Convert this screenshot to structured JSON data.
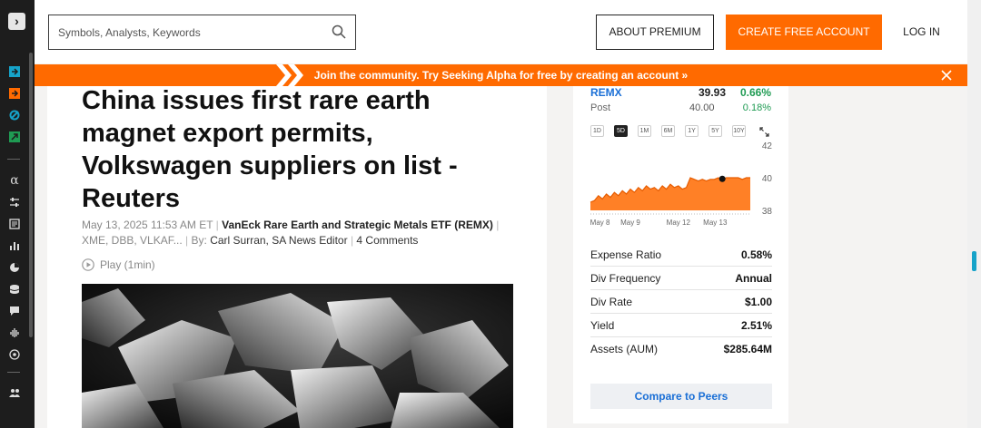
{
  "header": {
    "search_placeholder": "Symbols, Analysts, Keywords",
    "about_premium": "ABOUT PREMIUM",
    "create_account": "CREATE FREE ACCOUNT",
    "log_in": "LOG IN"
  },
  "promo": {
    "text": "Join the community. Try Seeking Alpha for free by creating an account »"
  },
  "article": {
    "headline": "China issues first rare earth magnet export permits, Volkswagen suppliers on list - Reuters",
    "date": "May 13, 2025 11:53 AM ET",
    "primary_ticker_name": "VanEck Rare Earth and Strategic Metals ETF (REMX)",
    "other_tickers": "XME, DBB, VLKAF...",
    "by_label": "By:",
    "author": "Carl Surran",
    "author_role": "SA News Editor",
    "comments": "4 Comments",
    "play_label": "Play (1min)"
  },
  "quote": {
    "symbol": "REMX",
    "price": "39.93",
    "change": "0.66%",
    "post_label": "Post",
    "post_price": "40.00",
    "post_change": "0.18%",
    "ranges": [
      "1D",
      "5D",
      "1M",
      "6M",
      "1Y",
      "5Y",
      "10Y"
    ],
    "active_range": "5D",
    "colors": {
      "up": "#1f9b53",
      "line": "#ff6a00",
      "link": "#1a6fd6"
    }
  },
  "chart_data": {
    "type": "area",
    "y_ticks": [
      "42",
      "40",
      "38"
    ],
    "ylim": [
      38,
      42
    ],
    "x_ticks": [
      "May 8",
      "May 9",
      "May 12",
      "May 13"
    ],
    "values": [
      38.5,
      38.6,
      38.9,
      38.7,
      39.0,
      38.8,
      39.1,
      38.9,
      39.2,
      39.0,
      39.3,
      39.1,
      39.4,
      39.2,
      39.5,
      39.3,
      39.4,
      39.2,
      39.5,
      39.3,
      39.6,
      39.4,
      39.5,
      39.3,
      39.4,
      40.0,
      39.9,
      39.8,
      39.9,
      39.8,
      39.9,
      39.9,
      40.0,
      39.9,
      40.0,
      40.0,
      40.0,
      40.0,
      39.9,
      40.0,
      40.0
    ],
    "marker_value": 39.93
  },
  "stats": [
    {
      "label": "Expense Ratio",
      "value": "0.58%"
    },
    {
      "label": "Div Frequency",
      "value": "Annual"
    },
    {
      "label": "Div Rate",
      "value": "$1.00"
    },
    {
      "label": "Yield",
      "value": "2.51%"
    },
    {
      "label": "Assets (AUM)",
      "value": "$285.64M"
    }
  ],
  "compare_label": "Compare to Peers"
}
